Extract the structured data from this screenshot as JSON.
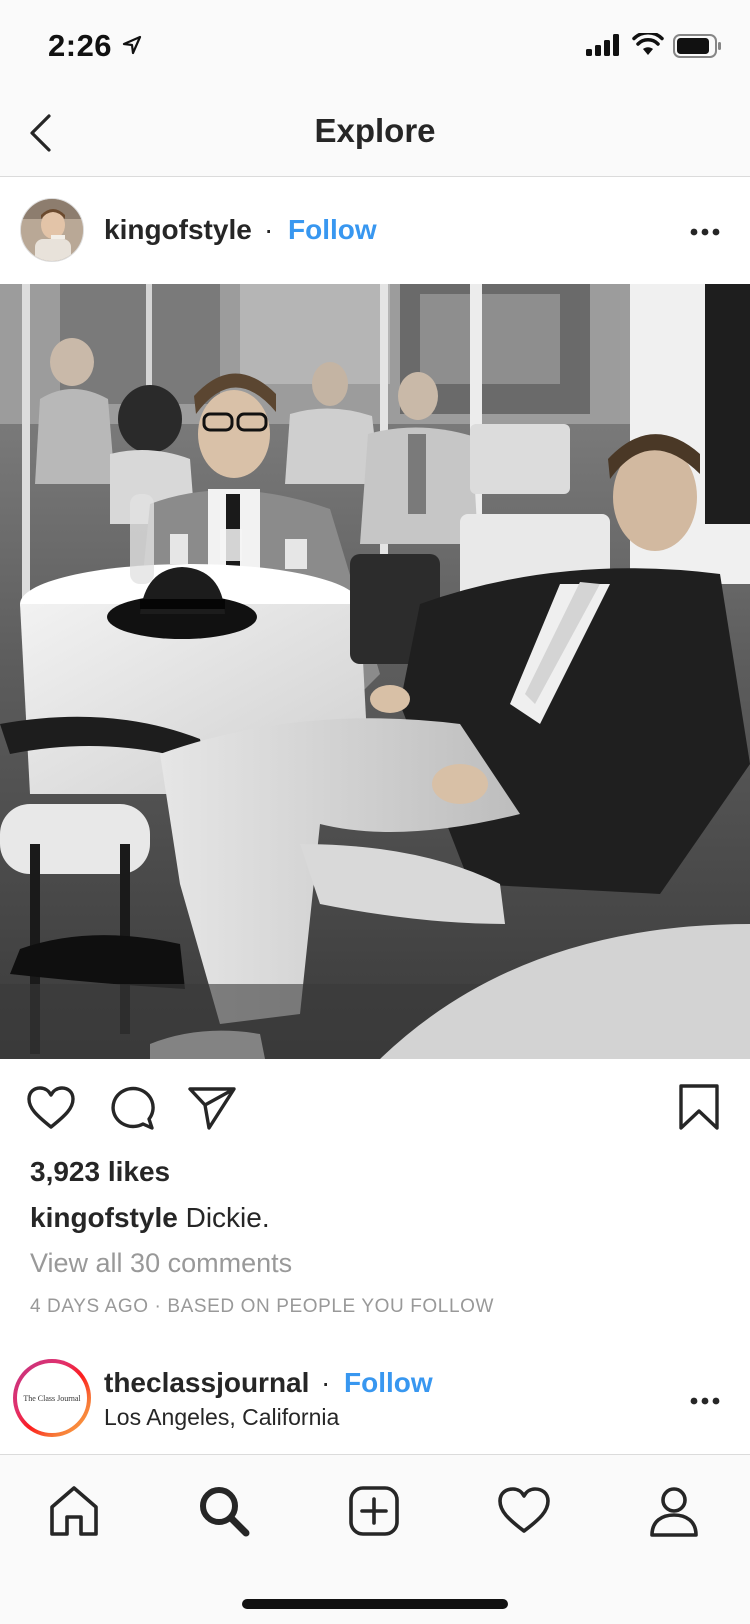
{
  "status_bar": {
    "time": "2:26"
  },
  "nav": {
    "title": "Explore"
  },
  "post": {
    "username": "kingofstyle",
    "separator": "·",
    "follow_label": "Follow",
    "likes": "3,923 likes",
    "caption_user": "kingofstyle",
    "caption_text": "Dickie.",
    "view_comments": "View all 30 comments",
    "timestamp": "4 DAYS AGO · BASED ON PEOPLE YOU FOLLOW"
  },
  "next_post": {
    "username": "theclassjournal",
    "separator": "·",
    "follow_label": "Follow",
    "location": "Los Angeles, California",
    "avatar_text": "The Class Journal"
  },
  "colors": {
    "link_blue": "#3897f0",
    "text": "#262626",
    "muted": "#999999",
    "bar_bg": "#fafafa"
  },
  "icons": {
    "back": "chevron-left-icon",
    "more": "more-horizontal-icon",
    "like": "heart-icon",
    "comment": "comment-bubble-icon",
    "share": "paper-plane-icon",
    "save": "bookmark-icon",
    "home": "home-icon",
    "search": "search-icon",
    "create": "plus-square-icon",
    "activity": "heart-icon",
    "profile": "person-icon"
  }
}
